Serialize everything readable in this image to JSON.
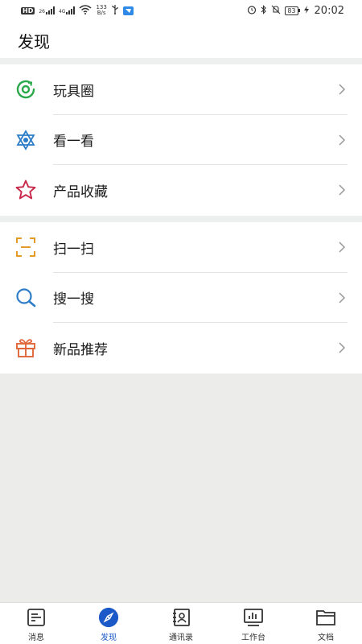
{
  "status_bar": {
    "hd": "HD",
    "sig1": "26",
    "sig2": "4G",
    "speed_value": "133",
    "speed_unit": "B/s",
    "battery": "83",
    "time": "20:02"
  },
  "header": {
    "title": "发现"
  },
  "sections": [
    {
      "items": [
        {
          "label": "玩具圈",
          "icon": "circle-refresh-icon",
          "color": "#2aa84a"
        },
        {
          "label": "看一看",
          "icon": "hexagram-icon",
          "color": "#2d7dc8"
        },
        {
          "label": "产品收藏",
          "icon": "star-icon",
          "color": "#c8284a"
        }
      ]
    },
    {
      "items": [
        {
          "label": "扫一扫",
          "icon": "scan-icon",
          "color": "#e49b2a"
        },
        {
          "label": "搜一搜",
          "icon": "search-icon",
          "color": "#2d7dc8"
        },
        {
          "label": "新品推荐",
          "icon": "gift-icon",
          "color": "#e0663a"
        }
      ]
    }
  ],
  "tabbar": {
    "tabs": [
      {
        "label": "消息",
        "icon": "message-icon",
        "active": false
      },
      {
        "label": "发现",
        "icon": "compass-icon",
        "active": true
      },
      {
        "label": "通讯录",
        "icon": "contacts-icon",
        "active": false
      },
      {
        "label": "工作台",
        "icon": "workbench-icon",
        "active": false
      },
      {
        "label": "文档",
        "icon": "folder-icon",
        "active": false
      }
    ]
  },
  "colors": {
    "accent": "#1b59c9",
    "background": "#ececea"
  }
}
